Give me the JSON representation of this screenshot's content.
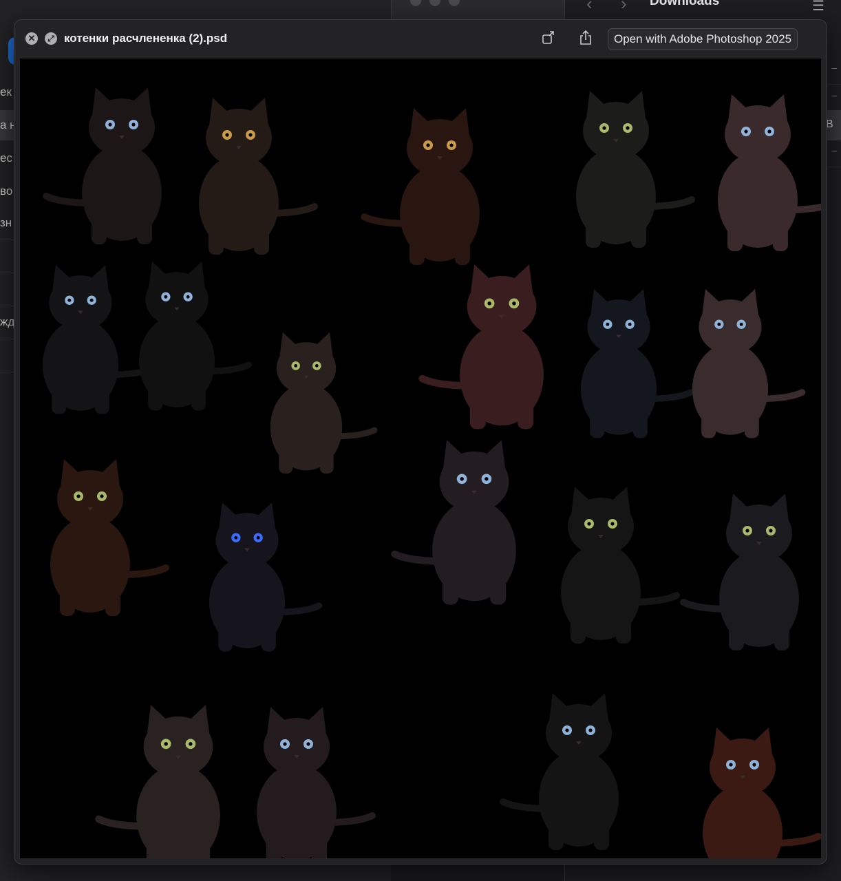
{
  "background_window": {
    "title": "Downloads",
    "sidebar_fragments": [
      "ек",
      "а н",
      "ес",
      "во",
      "зн",
      "жд"
    ],
    "right_selected_fragment": "B"
  },
  "quicklook": {
    "title": "котенки расчлененка (2).psd",
    "open_button_label": "Open with Adobe Photoshop 2025",
    "close_icon": "close-icon",
    "fullscreen_icon": "fullscreen-icon",
    "rotate_icon": "rotate-icon",
    "share_icon": "share-icon"
  },
  "image": {
    "background_color": "#000000",
    "subject": "kittens",
    "kitten_count": 21,
    "eye_colors": {
      "blue": "#8fb3d9",
      "green": "#a9b86a",
      "amber": "#c89a4a",
      "vivid_blue": "#3a6cff"
    }
  }
}
